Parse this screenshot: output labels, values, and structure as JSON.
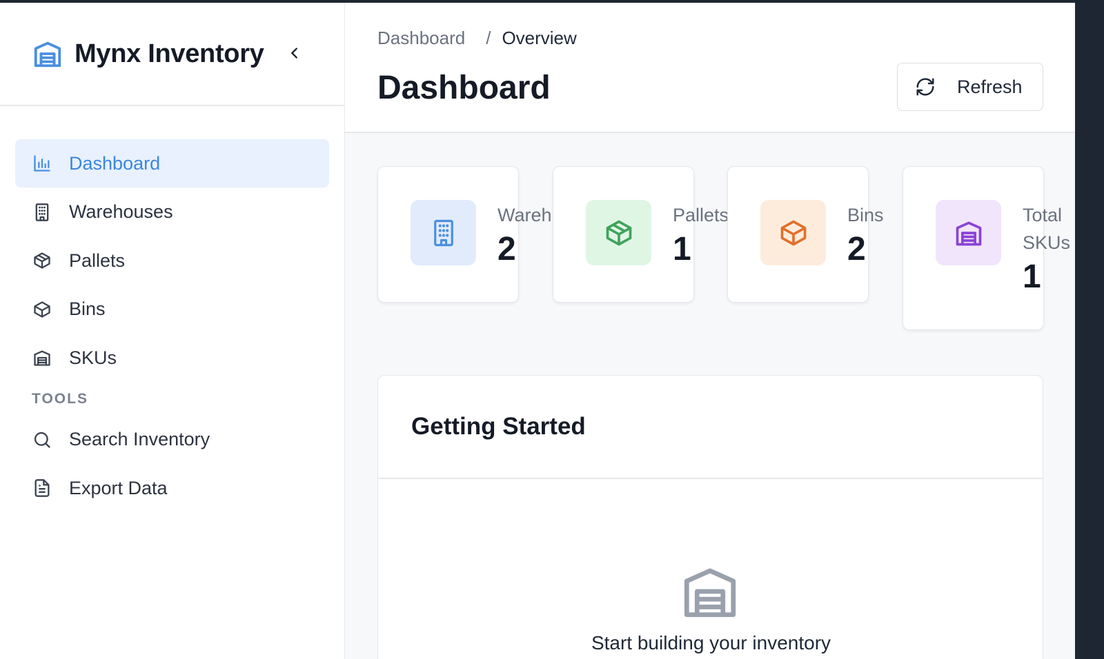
{
  "brand": {
    "name": "Mynx Inventory",
    "logo_icon": "warehouse-icon",
    "accent": "#4a8fe0"
  },
  "sidebar": {
    "items": [
      {
        "label": "Dashboard",
        "icon": "bar-chart-icon",
        "active": true
      },
      {
        "label": "Warehouses",
        "icon": "building-icon",
        "active": false
      },
      {
        "label": "Pallets",
        "icon": "package-icon",
        "active": false
      },
      {
        "label": "Bins",
        "icon": "box-icon",
        "active": false
      },
      {
        "label": "SKUs",
        "icon": "warehouse-icon",
        "active": false
      }
    ],
    "section_tools": "TOOLS",
    "tools": [
      {
        "label": "Search Inventory",
        "icon": "search-icon"
      },
      {
        "label": "Export Data",
        "icon": "file-text-icon"
      }
    ]
  },
  "header": {
    "breadcrumb": [
      "Dashboard",
      "/",
      "Overview"
    ],
    "title": "Dashboard",
    "refresh_label": "Refresh"
  },
  "stats": [
    {
      "label": "Wareh",
      "value": "2",
      "color": "#4a8fe0",
      "bg": "#e1ebfb",
      "icon": "building-icon"
    },
    {
      "label": "Pallets",
      "value": "1",
      "color": "#3fa35b",
      "bg": "#e0f6e5",
      "icon": "package-icon"
    },
    {
      "label": "Bins",
      "value": "2",
      "color": "#e0702a",
      "bg": "#fdecdc",
      "icon": "box-icon"
    },
    {
      "label_line1": "Total",
      "label_line2": "SKUs",
      "value": "1",
      "color": "#8a44d6",
      "bg": "#f1e5fb",
      "icon": "warehouse-icon"
    }
  ],
  "getting_started": {
    "title": "Getting Started",
    "empty_text": "Start building your inventory"
  }
}
